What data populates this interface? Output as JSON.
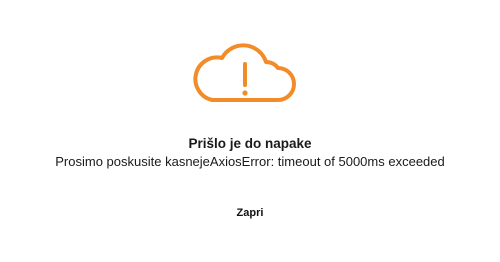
{
  "dialog": {
    "icon": "cloud-warning-icon",
    "icon_color": "#f28c28",
    "title": "Prišlo je do napake",
    "message": "Prosimo poskusite kasnejeAxiosError: timeout of 5000ms exceeded",
    "close_label": "Zapri"
  }
}
